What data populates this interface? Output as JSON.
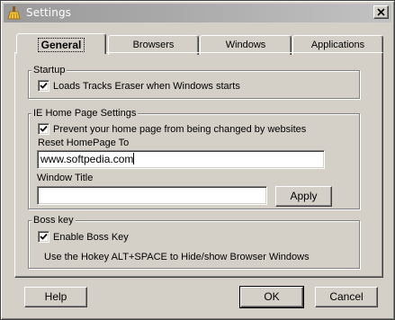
{
  "window": {
    "title": "Settings",
    "app_icon": "broom-icon",
    "close_icon": "close-icon"
  },
  "tabs": [
    {
      "label": "General",
      "active": true
    },
    {
      "label": "Browsers",
      "active": false
    },
    {
      "label": "Windows",
      "active": false
    },
    {
      "label": "Applications",
      "active": false
    }
  ],
  "startup": {
    "title": "Startup",
    "load_on_start": {
      "label": "Loads Tracks Eraser when Windows starts",
      "checked": true
    }
  },
  "ie_home": {
    "title": "IE Home Page Settings",
    "prevent_change": {
      "label": "Prevent your home page from being changed by websites",
      "checked": true
    },
    "reset_label": "Reset HomePage To",
    "reset_value": "www.softpedia.com",
    "window_title_label": "Window Title",
    "window_title_value": "",
    "apply_label": "Apply"
  },
  "boss_key": {
    "title": "Boss key",
    "enable": {
      "label": "Enable Boss Key",
      "checked": true
    },
    "hint": "Use the Hokey ALT+SPACE to Hide/show Browser Windows"
  },
  "footer": {
    "help_label": "Help",
    "ok_label": "OK",
    "cancel_label": "Cancel"
  },
  "colors": {
    "face": "#d4d0c8",
    "titlebar": "#a8a8a8",
    "field": "#ffffff"
  }
}
